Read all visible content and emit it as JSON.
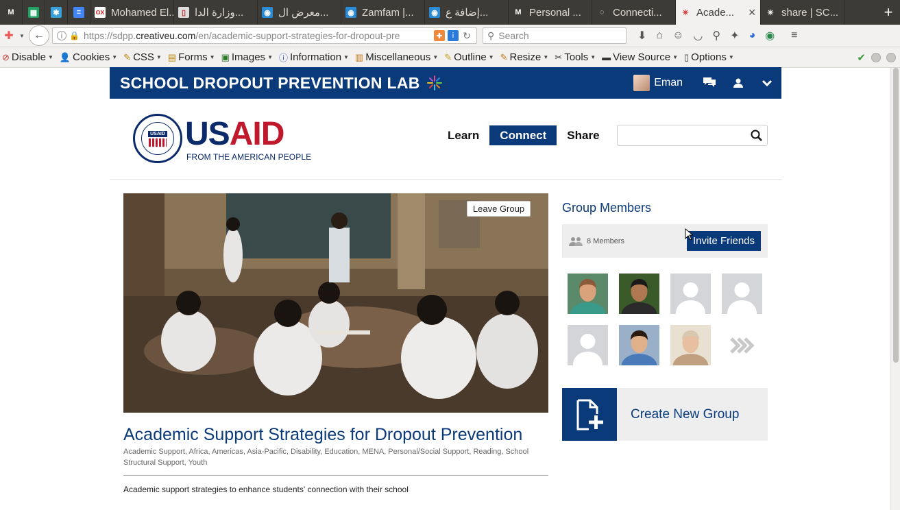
{
  "browser": {
    "tabs": [
      {
        "label": "",
        "fav_color": "#3c3b37",
        "fav_glyph": "M",
        "pinned": true
      },
      {
        "label": "",
        "fav_color": "#1ea362",
        "fav_glyph": "▦",
        "pinned": true
      },
      {
        "label": "",
        "fav_color": "#3aa0d8",
        "fav_glyph": "✱",
        "pinned": true
      },
      {
        "label": "",
        "fav_color": "#4285f4",
        "fav_glyph": "≡",
        "pinned": true
      },
      {
        "label": "Mohamed El...",
        "fav_color": "#ffffff",
        "fav_glyph": "ox",
        "pinned": false
      },
      {
        "label": "وزارة الدا...",
        "fav_color": "#dddddd",
        "fav_glyph": "▯",
        "pinned": false
      },
      {
        "label": "معرض ال...",
        "fav_color": "#2a8ad4",
        "fav_glyph": "◉",
        "pinned": false
      },
      {
        "label": "Zamfam |...",
        "fav_color": "#2a8ad4",
        "fav_glyph": "◉",
        "pinned": false
      },
      {
        "label": "إضافة ع...",
        "fav_color": "#2a8ad4",
        "fav_glyph": "◉",
        "pinned": false
      },
      {
        "label": "Personal ...",
        "fav_color": "#3c3b37",
        "fav_glyph": "M",
        "pinned": false
      },
      {
        "label": "Connecti...",
        "fav_color": "#3c3b37",
        "fav_glyph": "◌",
        "pinned": false
      },
      {
        "label": "Acade...",
        "fav_color": "#f2f1f0",
        "fav_glyph": "✳",
        "pinned": false,
        "active": true
      },
      {
        "label": "share | SC...",
        "fav_color": "#3c3b37",
        "fav_glyph": "✳",
        "pinned": false
      }
    ],
    "url_prefix": "https://sdpp.",
    "url_domain": "creativeu.com",
    "url_rest": "/en/academic-support-strategies-for-dropout-pre",
    "search_placeholder": "Search"
  },
  "devtoolbar": {
    "items": [
      {
        "label": "Disable",
        "icon": "⊘",
        "icon_color": "#cc2a2a"
      },
      {
        "label": "Cookies",
        "icon": "👤",
        "icon_color": "#333"
      },
      {
        "label": "CSS",
        "icon": "✎",
        "icon_color": "#b8860b"
      },
      {
        "label": "Forms",
        "icon": "▤",
        "icon_color": "#b8860b"
      },
      {
        "label": "Images",
        "icon": "▣",
        "icon_color": "#2a7a2a"
      },
      {
        "label": "Information",
        "icon": "ⓘ",
        "icon_color": "#2a5ab8"
      },
      {
        "label": "Miscellaneous",
        "icon": "▥",
        "icon_color": "#c87a1a"
      },
      {
        "label": "Outline",
        "icon": "✎",
        "icon_color": "#c8a01a"
      },
      {
        "label": "Resize",
        "icon": "✎",
        "icon_color": "#c87a1a"
      },
      {
        "label": "Tools",
        "icon": "✂",
        "icon_color": "#333"
      },
      {
        "label": "View Source",
        "icon": "▬",
        "icon_color": "#333"
      },
      {
        "label": "Options",
        "icon": "▯",
        "icon_color": "#333"
      }
    ]
  },
  "site": {
    "title": "SCHOOL DROPOUT PREVENTION LAB",
    "user_name": "Eman",
    "logo_word_us": "US",
    "logo_word_aid": "AID",
    "logo_tagline": "FROM THE AMERICAN PEOPLE",
    "seal_text": "USAID",
    "nav": [
      {
        "label": "Learn",
        "active": false
      },
      {
        "label": "Connect",
        "active": true
      },
      {
        "label": "Share",
        "active": false
      }
    ],
    "search_value": ""
  },
  "group": {
    "leave_label": "Leave Group",
    "title": "Academic Support Strategies for Dropout Prevention",
    "tags": [
      "Academic Support",
      "Africa",
      "Americas",
      "Asia-Pacific",
      "Disability",
      "Education",
      "MENA",
      "Personal/Social Support",
      "Reading",
      "School Structural Support",
      "Youth"
    ],
    "description": "Academic support strategies to enhance students' connection with their school"
  },
  "sidebar": {
    "members_title": "Group Members",
    "members_count": "8 Members",
    "invite_label": "Invite Friends",
    "members": [
      {
        "type": "photo",
        "bg": "#5a8a6a",
        "skin": "#d9a27a",
        "hair": "#8a5a3a",
        "shirt": "#3a9a8a"
      },
      {
        "type": "photo",
        "bg": "#3a5a2a",
        "skin": "#b07850",
        "hair": "#1a1a1a",
        "shirt": "#2a2a2a"
      },
      {
        "type": "blank"
      },
      {
        "type": "blank"
      },
      {
        "type": "blank"
      },
      {
        "type": "photo",
        "bg": "#9ab0c8",
        "skin": "#e0b08a",
        "hair": "#2a1a10",
        "shirt": "#4a7ab8"
      },
      {
        "type": "photo",
        "bg": "#e8e0d0",
        "skin": "#e6c0a0",
        "hair": "#d8c8b0",
        "shirt": "#c0a080"
      },
      {
        "type": "more"
      }
    ],
    "create_label": "Create New Group"
  },
  "colors": {
    "brand_blue": "#0a3a7a",
    "usaid_red": "#c0182d"
  }
}
